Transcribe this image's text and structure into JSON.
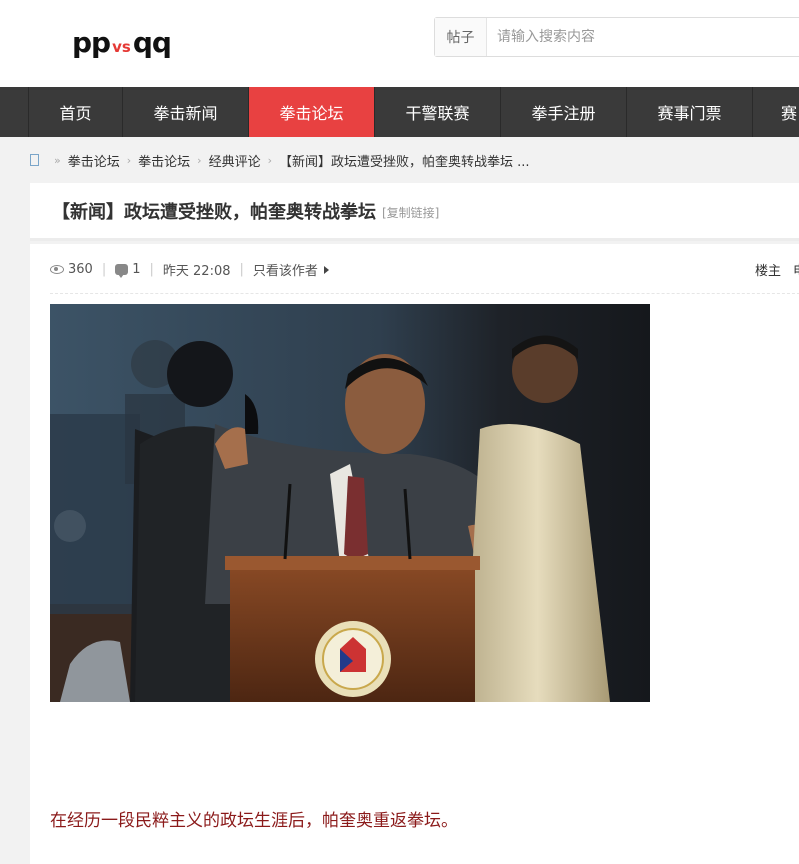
{
  "logo": {
    "part1": "pp",
    "part2": "vs",
    "part3": "qq"
  },
  "search": {
    "type_label": "帖子",
    "placeholder": "请输入搜索内容"
  },
  "nav": {
    "items": [
      {
        "label": "首页"
      },
      {
        "label": "拳击新闻"
      },
      {
        "label": "拳击论坛"
      },
      {
        "label": "干警联赛"
      },
      {
        "label": "拳手注册"
      },
      {
        "label": "赛事门票"
      },
      {
        "label": "赛"
      }
    ],
    "active_index": 2
  },
  "breadcrumb": {
    "separator": "»",
    "arrow": "›",
    "items": [
      "拳击论坛",
      "拳击论坛",
      "经典评论",
      "【新闻】政坛遭受挫败，帕奎奥转战拳坛 ..."
    ]
  },
  "post": {
    "title": "【新闻】政坛遭受挫败，帕奎奥转战拳坛",
    "copy_link": "[复制链接]",
    "views": "360",
    "comments": "1",
    "time": "昨天 22:08",
    "only_author": "只看该作者",
    "floor_label": "楼主",
    "floor_extra": "电",
    "body_text": "在经历一段民粹主义的政坛生涯后，帕奎奥重返拳坛。"
  },
  "colors": {
    "accent": "#e84141",
    "nav_bg": "#3a3a3a",
    "body_text": "#8b1a1a"
  }
}
